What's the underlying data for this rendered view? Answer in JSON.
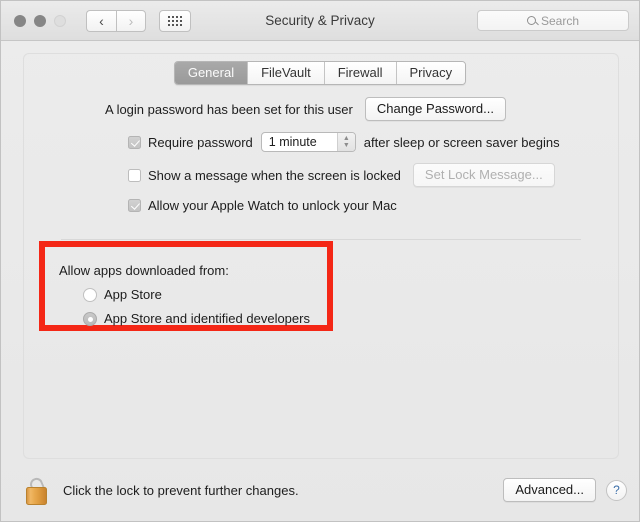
{
  "window": {
    "title": "Security & Privacy",
    "traffic_lights": [
      "close",
      "minimize",
      "zoom"
    ],
    "nav": {
      "back_icon": "chevron-left-icon",
      "forward_icon": "chevron-right-icon"
    },
    "show_all_icon": "grid-icon"
  },
  "search": {
    "placeholder": "Search",
    "icon": "search-icon"
  },
  "tabs": [
    {
      "label": "General",
      "active": true
    },
    {
      "label": "FileVault",
      "active": false
    },
    {
      "label": "Firewall",
      "active": false
    },
    {
      "label": "Privacy",
      "active": false
    }
  ],
  "general": {
    "login_password_text": "A login password has been set for this user",
    "change_password_label": "Change Password...",
    "require_password": {
      "label_before": "Require password",
      "delay_value": "1 minute",
      "label_after": "after sleep or screen saver begins",
      "checked": true
    },
    "show_message": {
      "label": "Show a message when the screen is locked",
      "checked": false,
      "button_label": "Set Lock Message...",
      "button_disabled": true
    },
    "apple_watch": {
      "label": "Allow your Apple Watch to unlock your Mac",
      "checked": true
    }
  },
  "gatekeeper": {
    "heading": "Allow apps downloaded from:",
    "options": [
      {
        "label": "App Store",
        "selected": false
      },
      {
        "label": "App Store and identified developers",
        "selected": true
      }
    ],
    "highlight_color": "#f42716"
  },
  "bottom": {
    "lock_icon": "unlocked-padlock-icon",
    "lock_text": "Click the lock to prevent further changes.",
    "advanced_label": "Advanced...",
    "help_label": "?"
  }
}
